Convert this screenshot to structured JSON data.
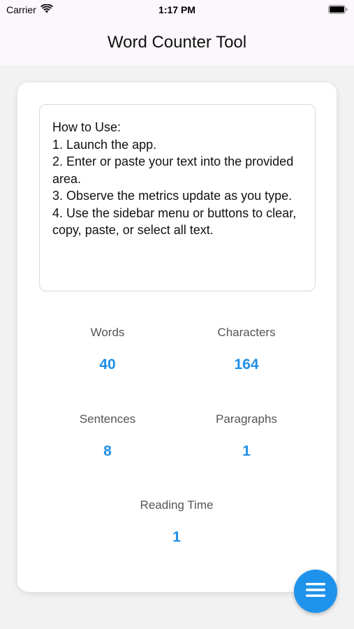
{
  "status_bar": {
    "carrier": "Carrier",
    "time": "1:17 PM",
    "wifi_icon": "wifi-icon",
    "battery_icon": "battery-icon"
  },
  "nav": {
    "title": "Word Counter Tool"
  },
  "editor": {
    "text": "How to Use:\n1. Launch the app.\n2. Enter or paste your text into the provided area.\n3. Observe the metrics update as you type.\n4. Use the sidebar menu or buttons to clear, copy, paste, or select all text."
  },
  "metrics": {
    "words": {
      "label": "Words",
      "value": "40"
    },
    "characters": {
      "label": "Characters",
      "value": "164"
    },
    "sentences": {
      "label": "Sentences",
      "value": "8"
    },
    "paragraphs": {
      "label": "Paragraphs",
      "value": "1"
    },
    "reading_time": {
      "label": "Reading Time",
      "value": "1"
    }
  },
  "fab": {
    "icon": "menu-icon"
  },
  "colors": {
    "accent": "#1f93ec",
    "metric_value": "#1f8fe6",
    "bar_background": "#fbf7fc",
    "page_background": "#f2f2f2"
  }
}
